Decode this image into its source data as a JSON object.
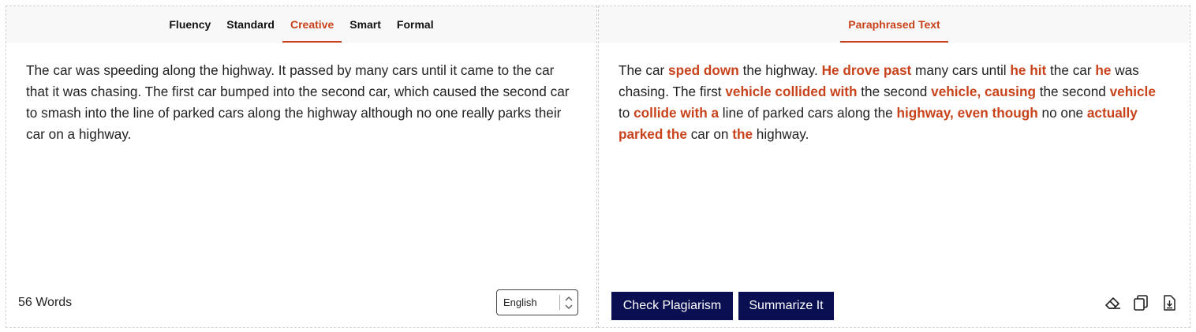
{
  "modes": [
    "Fluency",
    "Standard",
    "Creative",
    "Smart",
    "Formal"
  ],
  "active_mode": "Creative",
  "input": {
    "text": "The car was speeding along the highway. It passed by many cars until it came to the car that it was chasing. The first car bumped into the second car, which caused the second car to smash into the line of parked cars along the highway although no one really parks their car on a highway.",
    "word_count": "56 Words",
    "language": "English"
  },
  "output": {
    "tab_label": "Paraphrased Text",
    "segments": [
      {
        "t": "The car ",
        "h": false
      },
      {
        "t": "sped down",
        "h": true
      },
      {
        "t": " the highway. ",
        "h": false
      },
      {
        "t": "He drove past",
        "h": true
      },
      {
        "t": " many cars until ",
        "h": false
      },
      {
        "t": "he hit",
        "h": true
      },
      {
        "t": " the car ",
        "h": false
      },
      {
        "t": "he",
        "h": true
      },
      {
        "t": " was chasing. The first ",
        "h": false
      },
      {
        "t": "vehicle collided with",
        "h": true
      },
      {
        "t": " the second ",
        "h": false
      },
      {
        "t": "vehicle, causing",
        "h": true
      },
      {
        "t": " the second ",
        "h": false
      },
      {
        "t": "vehicle",
        "h": true
      },
      {
        "t": " to ",
        "h": false
      },
      {
        "t": "collide with a",
        "h": true
      },
      {
        "t": " line of parked cars along the ",
        "h": false
      },
      {
        "t": "highway, even though",
        "h": true
      },
      {
        "t": " no one ",
        "h": false
      },
      {
        "t": "actually parked the",
        "h": true
      },
      {
        "t": " car on ",
        "h": false
      },
      {
        "t": "the",
        "h": true
      },
      {
        "t": " highway.",
        "h": false
      }
    ]
  },
  "actions": {
    "check_plagiarism": "Check Plagiarism",
    "summarize": "Summarize It"
  },
  "icons": [
    "eraser-icon",
    "copy-icon",
    "download-icon"
  ],
  "colors": {
    "accent": "#c8431b",
    "button_bg": "#0a0f52",
    "tab_bar_bg": "#f8f8f8"
  }
}
